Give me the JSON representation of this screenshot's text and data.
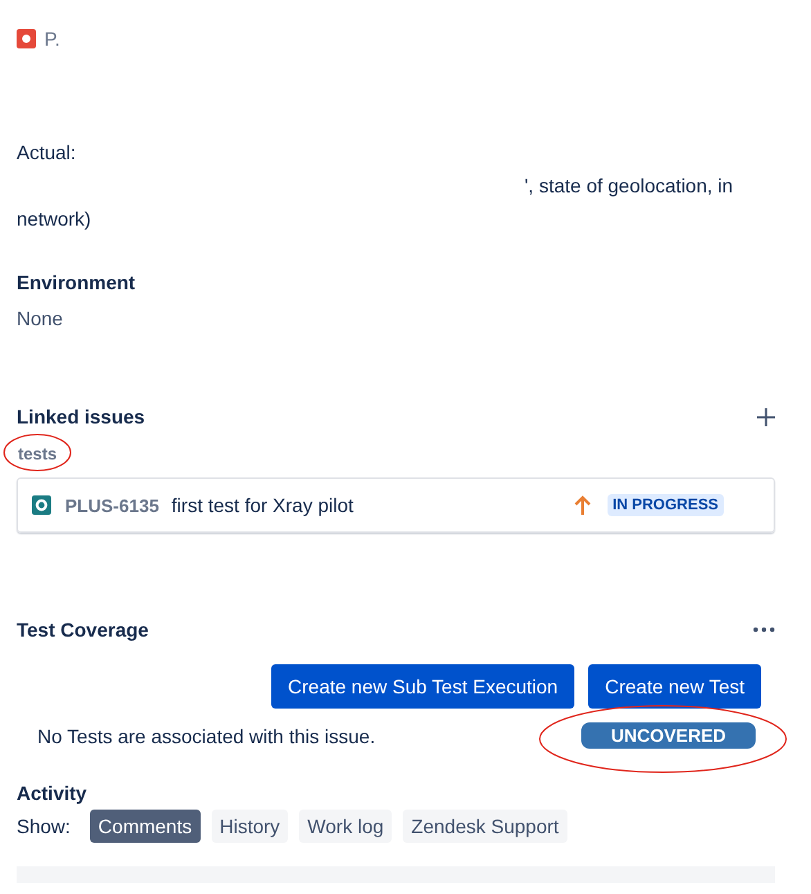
{
  "issue_type": {
    "label": "P."
  },
  "description": {
    "actual_heading": "Actual:",
    "actual_text_visible": "', state of geolocation, in",
    "actual_text_line2": "network)"
  },
  "environment": {
    "title": "Environment",
    "value": "None"
  },
  "linked_issues": {
    "title": "Linked issues",
    "relation": "tests",
    "relation_circled": true,
    "items": [
      {
        "key": "PLUS-6135",
        "summary": "first test for Xray pilot",
        "status": "IN PROGRESS"
      }
    ]
  },
  "test_coverage": {
    "title": "Test Coverage",
    "buttons": [
      "Create new Sub Test Execution",
      "Create new Test"
    ],
    "message": "No Tests are associated with this issue.",
    "status": "UNCOVERED",
    "status_circled": true
  },
  "activity": {
    "title": "Activity",
    "show_label": "Show:",
    "tabs": [
      {
        "label": "Comments",
        "selected": true
      },
      {
        "label": "History",
        "selected": false
      },
      {
        "label": "Work log",
        "selected": false
      },
      {
        "label": "Zendesk Support",
        "selected": false
      }
    ]
  }
}
